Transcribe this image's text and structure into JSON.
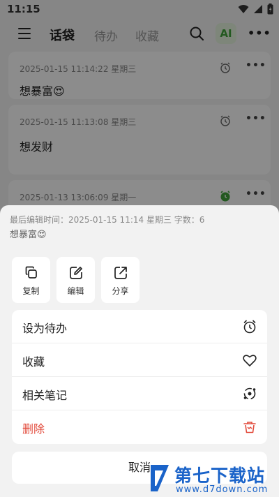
{
  "status_bar": {
    "time": "11:15"
  },
  "header": {
    "tabs": [
      {
        "label": "话袋",
        "active": true
      },
      {
        "label": "待办",
        "active": false
      },
      {
        "label": "收藏",
        "active": false
      }
    ],
    "ai_label": "AI"
  },
  "notes": [
    {
      "date": "2025-01-15 11:14:22 星期三",
      "text": "想暴富😍"
    },
    {
      "date": "2025-01-15 11:13:08 星期三",
      "text": "想发财"
    },
    {
      "date": "2025-01-13 13:06:09 星期一",
      "text": ""
    }
  ],
  "sheet": {
    "meta": "最后编辑时间：2025-01-15 11:14 星期三 字数：6",
    "preview": "想暴富😍",
    "actions": [
      {
        "label": "复制",
        "icon": "copy-icon"
      },
      {
        "label": "编辑",
        "icon": "edit-icon"
      },
      {
        "label": "分享",
        "icon": "share-icon"
      }
    ],
    "menu": [
      {
        "label": "设为待办",
        "icon": "alarm-clock-icon"
      },
      {
        "label": "收藏",
        "icon": "heart-icon"
      },
      {
        "label": "相关笔记",
        "icon": "related-notes-icon"
      },
      {
        "label": "删除",
        "icon": "trash-icon",
        "color": "#e24a3b"
      }
    ],
    "cancel_label": "取消"
  },
  "watermark": {
    "title": "第七下载站",
    "url": "www.d7down.com"
  },
  "colors": {
    "accent": "#41a33b",
    "danger": "#e24a3b",
    "watermark": "#1a63c9"
  }
}
